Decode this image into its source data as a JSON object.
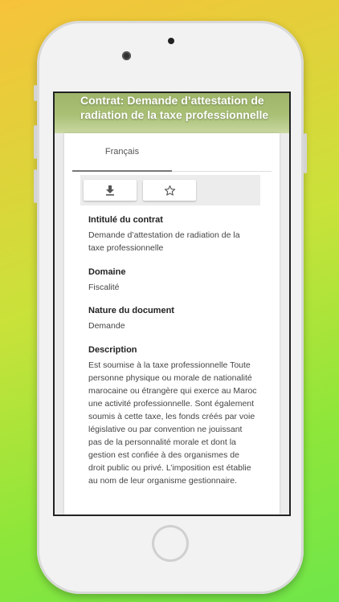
{
  "header": {
    "title": "Contrat: Demande d’attestation de radiation de la taxe professionnelle"
  },
  "tabs": [
    {
      "label": "Français"
    }
  ],
  "actions": {
    "download_icon": "download-icon",
    "favorite_icon": "star-outline-icon"
  },
  "fields": {
    "intitule": {
      "label": "Intitulé du contrat",
      "value": "Demande d’attestation de radiation de la taxe professionnelle"
    },
    "domaine": {
      "label": "Domaine",
      "value": "Fiscalité"
    },
    "nature": {
      "label": "Nature du document",
      "value": "Demande"
    },
    "description": {
      "label": "Description",
      "value": "Est soumise à la taxe professionnelle Toute personne physique ou morale de nationalité marocaine ou étrangère qui exerce au Maroc une activité professionnelle. Sont également soumis à cette taxe, les fonds créés par voie législative ou par convention ne jouissant pas de la personnalité morale et dont la gestion est confiée à des organismes de droit public ou privé. L’imposition est établie au nom de leur organisme gestionnaire."
    }
  }
}
